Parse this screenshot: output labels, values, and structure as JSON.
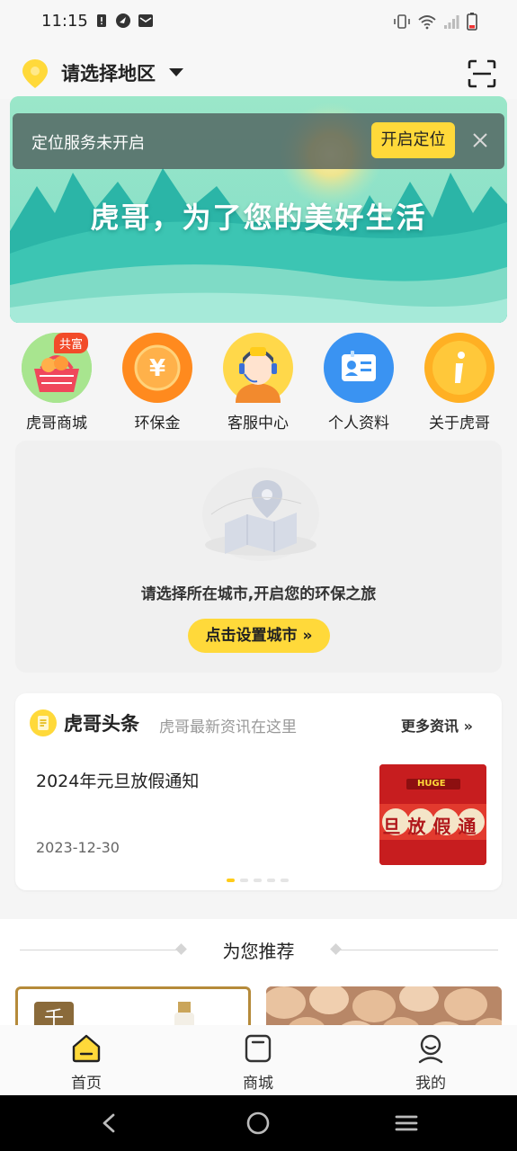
{
  "status_bar": {
    "time": "11:15"
  },
  "header": {
    "region_label": "请选择地区"
  },
  "banner": {
    "headline": "虎哥，为了您的美好生活"
  },
  "location_toast": {
    "message": "定位服务未开启",
    "enable_button": "开启定位"
  },
  "quick_menu": [
    {
      "label": "虎哥商城",
      "badge": "共富",
      "icon": "basket-icon"
    },
    {
      "label": "环保金",
      "icon": "yuan-coin-icon"
    },
    {
      "label": "客服中心",
      "icon": "customer-service-icon"
    },
    {
      "label": "个人资料",
      "icon": "profile-card-icon"
    },
    {
      "label": "关于虎哥",
      "icon": "info-icon"
    }
  ],
  "city_card": {
    "message": "请选择所在城市,开启您的环保之旅",
    "button": "点击设置城市 »"
  },
  "news": {
    "title": "虎哥头条",
    "subtitle": "虎哥最新资讯在这里",
    "more": "更多资讯 »",
    "item_title": "2024年元旦放假通知",
    "item_date": "2023-12-30",
    "thumb_brand": "HUGE",
    "thumb_text": "旦放假通"
  },
  "recommend": {
    "title": "为您推荐",
    "card1_text": "千"
  },
  "bottom_nav": [
    {
      "label": "首页",
      "icon": "home-icon",
      "active": true
    },
    {
      "label": "商城",
      "icon": "shop-icon",
      "active": false
    },
    {
      "label": "我的",
      "icon": "user-icon",
      "active": false
    }
  ],
  "colors": {
    "accent": "#ffd93a",
    "badge": "#f24b2a",
    "banner_bg": "#8fe0c8"
  }
}
